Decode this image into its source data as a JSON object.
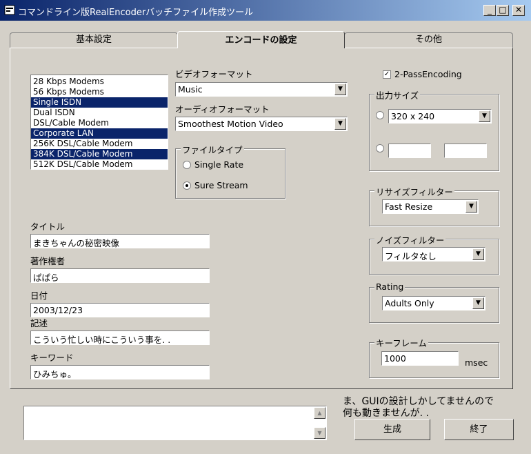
{
  "window": {
    "title": "コマンドライン版RealEncoderバッチファイル作成ツール",
    "minimize": "_",
    "maximize": "□",
    "close": "✕"
  },
  "tabs": [
    {
      "label": "基本設定"
    },
    {
      "label": "エンコードの設定"
    },
    {
      "label": "その他"
    }
  ],
  "audience_list": [
    {
      "label": "28 Kbps Modems",
      "selected": false
    },
    {
      "label": "56 Kbps Modems",
      "selected": false
    },
    {
      "label": "Single ISDN",
      "selected": true
    },
    {
      "label": "Dual ISDN",
      "selected": false
    },
    {
      "label": "DSL/Cable Modem",
      "selected": false
    },
    {
      "label": "Corporate LAN",
      "selected": true
    },
    {
      "label": "256K DSL/Cable Modem",
      "selected": false
    },
    {
      "label": "384K DSL/Cable Modem",
      "selected": true
    },
    {
      "label": "512K DSL/Cable Modem",
      "selected": false
    }
  ],
  "video_format": {
    "label": "ビデオフォーマット",
    "value": "Music"
  },
  "audio_format": {
    "label": "オーディオフォーマット",
    "value": "Smoothest Motion Video"
  },
  "file_type": {
    "label": "ファイルタイプ",
    "single": "Single Rate",
    "sure": "Sure Stream",
    "selected": "sure"
  },
  "meta": {
    "title_label": "タイトル",
    "title_value": "まきちゃんの秘密映像",
    "author_label": "著作権者",
    "author_value": "ぱぱら",
    "date_label": "日付",
    "date_value": "2003/12/23",
    "desc_label": "記述",
    "desc_value": "こういう忙しい時にこういう事を. .",
    "keyword_label": "キーワード",
    "keyword_value": "ひみちゅ。"
  },
  "two_pass": {
    "label": "2-PassEncoding",
    "checked": true
  },
  "output_size": {
    "label": "出力サイズ",
    "preset": "320 x 240",
    "width": "",
    "height": ""
  },
  "resize_filter": {
    "label": "リサイズフィルター",
    "value": "Fast Resize"
  },
  "noise_filter": {
    "label": "ノイズフィルター",
    "value": "フィルタなし"
  },
  "rating": {
    "label": "Rating",
    "value": "Adults Only"
  },
  "keyframe": {
    "label": "キーフレーム",
    "value": "1000",
    "unit": "msec"
  },
  "footer": {
    "note_line1": "ま、GUIの設計しかしてませんので",
    "note_line2": "何も動きませんが. .",
    "generate": "生成",
    "exit": "終了"
  },
  "icons": {
    "dropdown": "▼",
    "scroll_up": "▲",
    "scroll_down": "▼",
    "checkmark": "✓"
  }
}
